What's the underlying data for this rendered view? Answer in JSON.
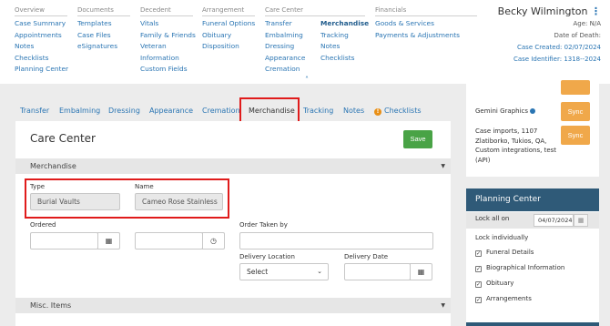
{
  "nav": {
    "groups": [
      {
        "head": "Overview",
        "items": [
          "Case Summary",
          "Appointments",
          "Notes",
          "Checklists",
          "Planning Center"
        ]
      },
      {
        "head": "Documents",
        "items": [
          "Templates",
          "Case Files",
          "eSignatures"
        ]
      },
      {
        "head": "Decedent",
        "items": [
          "Vitals",
          "Family & Friends",
          "Veteran",
          "Information",
          "Custom Fields"
        ]
      },
      {
        "head": "Arrangement",
        "items": [
          "Funeral Options",
          "Obituary",
          "Disposition"
        ]
      },
      {
        "head": "Care Center",
        "col1": [
          "Transfer",
          "Embalming",
          "Dressing",
          "Appearance",
          "Cremation"
        ],
        "col2": [
          "Merchandise",
          "Tracking",
          "Notes",
          "Checklists"
        ]
      },
      {
        "head": "Financials",
        "items": [
          "Goods & Services",
          "Payments & Adjustments"
        ]
      }
    ],
    "collapse_icon": "double-chevron-up-icon"
  },
  "person": {
    "name": "Becky Wilmington",
    "menu_icon": "vertical-dots-icon",
    "age": "Age: N/A",
    "dod": "Date of Death:",
    "case_created_label": "Case Created: 02/07/2024",
    "case_identifier": "Case Identifier: 1318--2024"
  },
  "tabs": {
    "transfer": "Transfer",
    "embalming": "Embalming",
    "dressing": "Dressing",
    "appearance": "Appearance",
    "cremation": "Cremation",
    "merchandise": "Merchandise",
    "tracking": "Tracking",
    "notes": "Notes",
    "checklists": "Checklists",
    "warn_glyph": "!"
  },
  "card": {
    "title": "Care Center",
    "save": "Save",
    "section1": "Merchandise",
    "section2": "Misc. Items",
    "type_label": "Type",
    "type_value": "Burial Vaults",
    "name_label": "Name",
    "name_value": "Cameo Rose Stainless",
    "ordered_label": "Ordered",
    "order_taken_label": "Order Taken by",
    "delivery_location_label": "Delivery Location",
    "delivery_location_value": "Select",
    "delivery_date_label": "Delivery Date",
    "calendar_glyph": "▦",
    "clock_glyph": "◷",
    "caret_glyph": "▼",
    "select_glyph": "⌄"
  },
  "right_panel": {
    "gemini": "Gemini Graphics",
    "case_imports": "Case imports, 1107 Zlatiborko, Tukios, QA, Custom integrations, test (API)",
    "sync": "Sync"
  },
  "planning": {
    "title": "Planning Center",
    "lock_all": "Lock all on",
    "lock_date": "04/07/2024",
    "lock_individually": "Lock individually",
    "items": [
      "Funeral Details",
      "Biographical Information",
      "Obituary",
      "Arrangements"
    ],
    "check_glyph": "✓"
  },
  "colors": {
    "link": "#2a75b3",
    "save": "#49a346",
    "sync": "#f0a84a",
    "planning_header": "#2f5a78",
    "highlight": "#e01b1b"
  }
}
